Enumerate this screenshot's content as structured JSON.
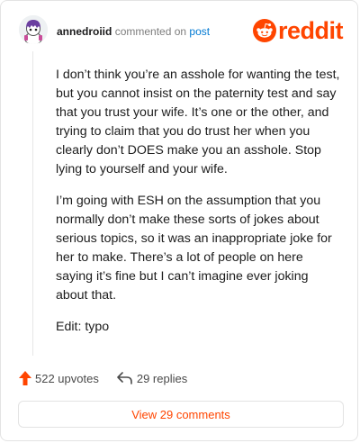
{
  "comment": {
    "author": "annedroiid",
    "action": "commented on",
    "post_link": "post",
    "paragraphs": [
      "I don’t think you’re an asshole for wanting the test, but you cannot insist on the paternity test and say that you trust your wife. It’s one or the other, and trying to claim that you do trust her when you clearly don’t DOES make you an asshole. Stop lying to yourself and your wife.",
      "I’m going with ESH on the assumption that you normally don’t make these sorts of jokes about serious topics, so it was an inappropriate joke for her to make. There’s a lot of people on here saying it’s fine but I can’t imagine ever joking about that.",
      "Edit: typo"
    ]
  },
  "brand": {
    "logo_text": "reddit",
    "accent_color": "#ff4500",
    "link_color": "#0079d3"
  },
  "footer": {
    "upvotes_label": "522 upvotes",
    "replies_label": "29 replies",
    "upvote_icon": "upvote-arrow-icon",
    "reply_icon": "reply-arrow-icon"
  },
  "view_button": {
    "label": "View 29 comments"
  }
}
